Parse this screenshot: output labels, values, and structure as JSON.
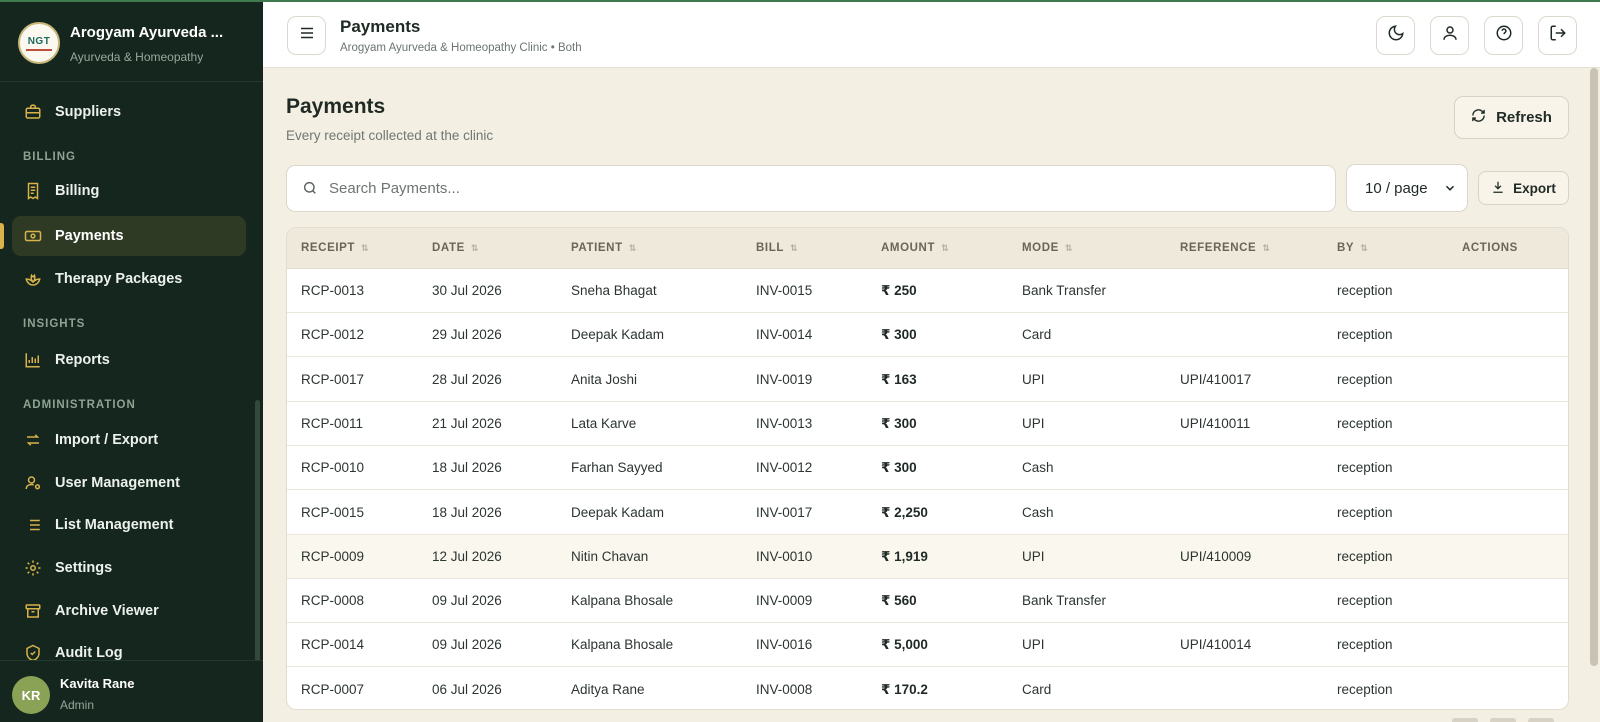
{
  "app": {
    "brand_name": "Arogyam Ayurveda ...",
    "brand_sub": "Ayurveda & Homeopathy",
    "logo_text": "NGT"
  },
  "sidebar": {
    "items": [
      {
        "label": "Suppliers",
        "icon": "briefcase-icon"
      },
      {
        "label": "Billing",
        "icon": "receipt-icon"
      },
      {
        "label": "Payments",
        "icon": "banknote-icon",
        "active": true
      },
      {
        "label": "Therapy Packages",
        "icon": "lotus-icon"
      },
      {
        "label": "Reports",
        "icon": "bar-chart-icon"
      },
      {
        "label": "Import / Export",
        "icon": "arrows-swap-icon"
      },
      {
        "label": "User Management",
        "icon": "user-cog-icon"
      },
      {
        "label": "List Management",
        "icon": "list-icon"
      },
      {
        "label": "Settings",
        "icon": "gear-icon"
      },
      {
        "label": "Archive Viewer",
        "icon": "archive-icon"
      },
      {
        "label": "Audit Log",
        "icon": "shield-check-icon"
      }
    ],
    "sections": {
      "billing": "BILLING",
      "insights": "INSIGHTS",
      "administration": "ADMINISTRATION"
    },
    "user": {
      "initials": "KR",
      "name": "Kavita Rane",
      "role": "Admin"
    }
  },
  "header": {
    "title": "Payments",
    "subtitle": "Arogyam Ayurveda & Homeopathy Clinic • Both",
    "actions": [
      "theme-toggle",
      "profile",
      "help",
      "logout"
    ]
  },
  "page": {
    "title": "Payments",
    "subtitle": "Every receipt collected at the clinic",
    "refresh_label": "Refresh",
    "search_placeholder": "Search Payments...",
    "search_value": "",
    "per_page": "10 / page",
    "export_label": "Export"
  },
  "table": {
    "columns": [
      "RECEIPT",
      "DATE",
      "PATIENT",
      "BILL",
      "AMOUNT",
      "MODE",
      "REFERENCE",
      "BY",
      "ACTIONS"
    ],
    "rows": [
      {
        "receipt": "RCP-0013",
        "date": "30 Jul 2026",
        "patient": "Sneha Bhagat",
        "bill": "INV-0015",
        "amount": "₹ 250",
        "mode": "Bank Transfer",
        "reference": "",
        "by": "reception"
      },
      {
        "receipt": "RCP-0012",
        "date": "29 Jul 2026",
        "patient": "Deepak Kadam",
        "bill": "INV-0014",
        "amount": "₹ 300",
        "mode": "Card",
        "reference": "",
        "by": "reception"
      },
      {
        "receipt": "RCP-0017",
        "date": "28 Jul 2026",
        "patient": "Anita Joshi",
        "bill": "INV-0019",
        "amount": "₹ 163",
        "mode": "UPI",
        "reference": "UPI/410017",
        "by": "reception"
      },
      {
        "receipt": "RCP-0011",
        "date": "21 Jul 2026",
        "patient": "Lata Karve",
        "bill": "INV-0013",
        "amount": "₹ 300",
        "mode": "UPI",
        "reference": "UPI/410011",
        "by": "reception"
      },
      {
        "receipt": "RCP-0010",
        "date": "18 Jul 2026",
        "patient": "Farhan Sayyed",
        "bill": "INV-0012",
        "amount": "₹ 300",
        "mode": "Cash",
        "reference": "",
        "by": "reception"
      },
      {
        "receipt": "RCP-0015",
        "date": "18 Jul 2026",
        "patient": "Deepak Kadam",
        "bill": "INV-0017",
        "amount": "₹ 2,250",
        "mode": "Cash",
        "reference": "",
        "by": "reception"
      },
      {
        "receipt": "RCP-0009",
        "date": "12 Jul 2026",
        "patient": "Nitin Chavan",
        "bill": "INV-0010",
        "amount": "₹ 1,919",
        "mode": "UPI",
        "reference": "UPI/410009",
        "by": "reception",
        "highlighted": true
      },
      {
        "receipt": "RCP-0008",
        "date": "09 Jul 2026",
        "patient": "Kalpana Bhosale",
        "bill": "INV-0009",
        "amount": "₹ 560",
        "mode": "Bank Transfer",
        "reference": "",
        "by": "reception"
      },
      {
        "receipt": "RCP-0014",
        "date": "09 Jul 2026",
        "patient": "Kalpana Bhosale",
        "bill": "INV-0016",
        "amount": "₹ 5,000",
        "mode": "UPI",
        "reference": "UPI/410014",
        "by": "reception"
      },
      {
        "receipt": "RCP-0007",
        "date": "06 Jul 2026",
        "patient": "Aditya Rane",
        "bill": "INV-0008",
        "amount": "₹ 170.2",
        "mode": "Card",
        "reference": "",
        "by": "reception"
      }
    ]
  },
  "colors": {
    "sidebar_bg": "#14261d",
    "active_item_bg": "#2f3a24",
    "accent_gold": "#d8b24a",
    "page_bg": "#f4efe3",
    "table_header_bg": "#efe9dc"
  }
}
